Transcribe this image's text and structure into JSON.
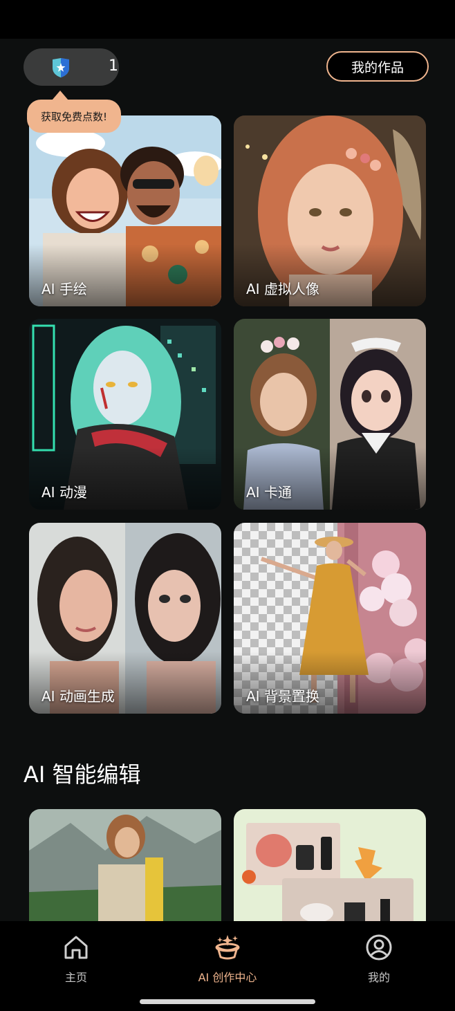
{
  "points": {
    "value": "1",
    "icon": "shield-star-icon"
  },
  "header": {
    "my_works_label": "我的作品"
  },
  "tooltip": {
    "text": "获取免费点数!"
  },
  "cards": [
    {
      "label": "AI 手绘"
    },
    {
      "label": "AI 虚拟人像"
    },
    {
      "label": "AI 动漫"
    },
    {
      "label": "AI 卡通"
    },
    {
      "label": "AI 动画生成"
    },
    {
      "label": "AI 背景置换"
    }
  ],
  "section": {
    "title": "AI 智能编辑"
  },
  "nav": [
    {
      "label": "主页",
      "icon": "home-icon"
    },
    {
      "label": "AI 创作中心",
      "icon": "ai-hat-icon"
    },
    {
      "label": "我的",
      "icon": "profile-icon"
    }
  ],
  "colors": {
    "accent": "#f0b58e",
    "background": "#0d0f0f",
    "nav_active": "#f0b58e"
  }
}
